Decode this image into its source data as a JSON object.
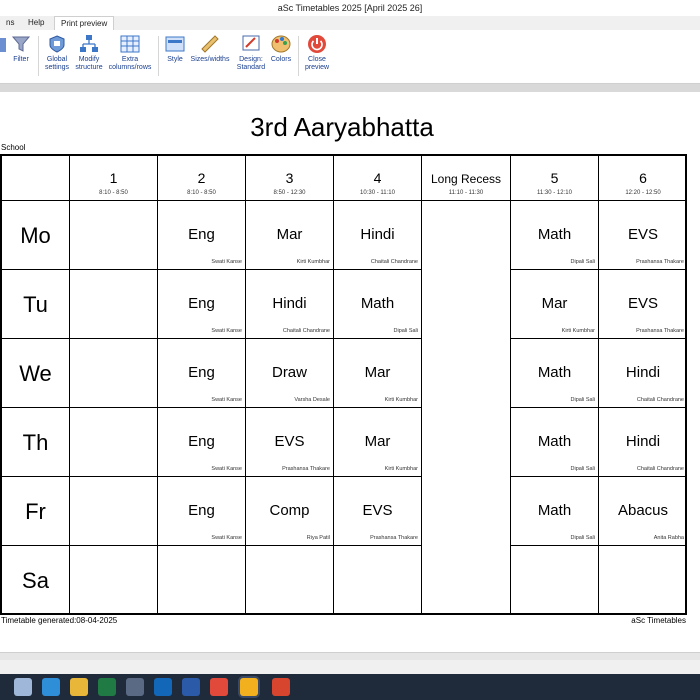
{
  "app": {
    "title": "aSc Timetables 2025    [April 2025 26]"
  },
  "menu": {
    "tabs": [
      "ns",
      "Help",
      "Print preview"
    ]
  },
  "ribbon": {
    "buttons": [
      {
        "label1": "Filter",
        "label2": ""
      },
      {
        "label1": "Global",
        "label2": "settings"
      },
      {
        "label1": "Modify",
        "label2": "structure"
      },
      {
        "label1": "Extra",
        "label2": "columns/rows"
      },
      {
        "label1": "Style",
        "label2": ""
      },
      {
        "label1": "Sizes/widths",
        "label2": ""
      },
      {
        "label1": "Design:",
        "label2": "Standard"
      },
      {
        "label1": "Colors",
        "label2": ""
      },
      {
        "label1": "Close",
        "label2": "preview"
      }
    ]
  },
  "document": {
    "title": "3rd Aaryabhatta",
    "school_label": "School",
    "footer_left": "Timetable generated:08-04-2025",
    "footer_right": "aSc Timetables"
  },
  "timetable": {
    "periods": [
      {
        "num": "1",
        "time": "8:10 - 8:50"
      },
      {
        "num": "2",
        "time": "8:10 - 8:50"
      },
      {
        "num": "3",
        "time": "8:50 - 12:30"
      },
      {
        "num": "4",
        "time": "10:30 - 11:10"
      },
      {
        "num": "Long Recess",
        "time": "11:10 - 11:30"
      },
      {
        "num": "5",
        "time": "11:30 - 12:10"
      },
      {
        "num": "6",
        "time": "12:20 - 12:50"
      }
    ],
    "days": [
      {
        "name": "Mo",
        "cells": [
          {
            "subject": "",
            "teacher": ""
          },
          {
            "subject": "Eng",
            "teacher": "Swati Kanse"
          },
          {
            "subject": "Mar",
            "teacher": "Kirti Kumbhar"
          },
          {
            "subject": "Hindi",
            "teacher": "Chaitali Chandrane"
          },
          {
            "subject": "",
            "teacher": ""
          },
          {
            "subject": "Math",
            "teacher": "Dipali Sali"
          },
          {
            "subject": "EVS",
            "teacher": "Prashansa Thakare"
          }
        ]
      },
      {
        "name": "Tu",
        "cells": [
          {
            "subject": "",
            "teacher": ""
          },
          {
            "subject": "Eng",
            "teacher": "Swati Kanse"
          },
          {
            "subject": "Hindi",
            "teacher": "Chaitali Chandrane"
          },
          {
            "subject": "Math",
            "teacher": "Dipali Sali"
          },
          {
            "subject": "",
            "teacher": ""
          },
          {
            "subject": "Mar",
            "teacher": "Kirti Kumbhar"
          },
          {
            "subject": "EVS",
            "teacher": "Prashansa Thakare"
          }
        ]
      },
      {
        "name": "We",
        "cells": [
          {
            "subject": "",
            "teacher": ""
          },
          {
            "subject": "Eng",
            "teacher": "Swati Kanse"
          },
          {
            "subject": "Draw",
            "teacher": "Varsha Desale"
          },
          {
            "subject": "Mar",
            "teacher": "Kirti Kumbhar"
          },
          {
            "subject": "",
            "teacher": ""
          },
          {
            "subject": "Math",
            "teacher": "Dipali Sali"
          },
          {
            "subject": "Hindi",
            "teacher": "Chaitali Chandrane"
          }
        ]
      },
      {
        "name": "Th",
        "cells": [
          {
            "subject": "",
            "teacher": ""
          },
          {
            "subject": "Eng",
            "teacher": "Swati Kanse"
          },
          {
            "subject": "EVS",
            "teacher": "Prashansa Thakare"
          },
          {
            "subject": "Mar",
            "teacher": "Kirti Kumbhar"
          },
          {
            "subject": "",
            "teacher": ""
          },
          {
            "subject": "Math",
            "teacher": "Dipali Sali"
          },
          {
            "subject": "Hindi",
            "teacher": "Chaitali Chandrane"
          }
        ]
      },
      {
        "name": "Fr",
        "cells": [
          {
            "subject": "",
            "teacher": ""
          },
          {
            "subject": "Eng",
            "teacher": "Swati Kanse"
          },
          {
            "subject": "Comp",
            "teacher": "Riya Patil"
          },
          {
            "subject": "EVS",
            "teacher": "Prashansa Thakare"
          },
          {
            "subject": "",
            "teacher": ""
          },
          {
            "subject": "Math",
            "teacher": "Dipali Sali"
          },
          {
            "subject": "Abacus",
            "teacher": "Anita Rabha"
          }
        ]
      },
      {
        "name": "Sa",
        "cells": [
          {
            "subject": "",
            "teacher": ""
          },
          {
            "subject": "",
            "teacher": ""
          },
          {
            "subject": "",
            "teacher": ""
          },
          {
            "subject": "",
            "teacher": ""
          },
          {
            "subject": "",
            "teacher": ""
          },
          {
            "subject": "",
            "teacher": ""
          },
          {
            "subject": "",
            "teacher": ""
          }
        ]
      }
    ]
  },
  "taskbar": {
    "icons": [
      {
        "name": "task-view-icon",
        "color": "#9fb7d8"
      },
      {
        "name": "edge-icon",
        "color": "#2e8fd8"
      },
      {
        "name": "file-explorer-icon",
        "color": "#e8b73a"
      },
      {
        "name": "excel-icon",
        "color": "#1f7a44"
      },
      {
        "name": "store-icon",
        "color": "#5a6a84"
      },
      {
        "name": "outlook-icon",
        "color": "#1367b8"
      },
      {
        "name": "word-icon",
        "color": "#2b5aa8"
      },
      {
        "name": "chrome-icon",
        "color": "#e14a3b"
      },
      {
        "name": "asc-timetables-icon",
        "color": "#f2b01e"
      },
      {
        "name": "chrome-profile-icon",
        "color": "#d8452f"
      }
    ]
  }
}
